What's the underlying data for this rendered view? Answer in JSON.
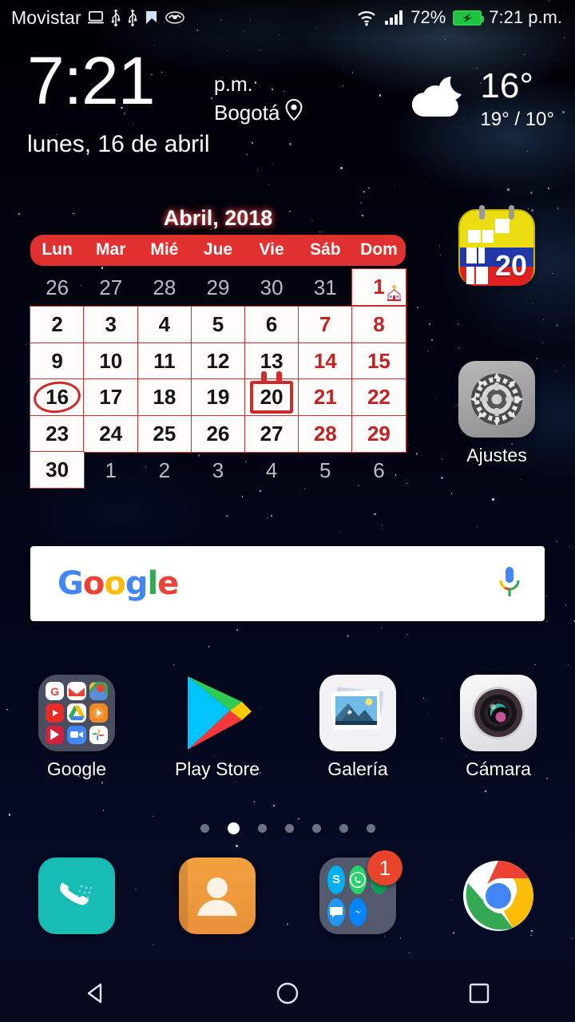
{
  "status_bar": {
    "carrier": "Movistar",
    "icons_left": [
      "laptop-icon",
      "usb-icon",
      "usb-icon",
      "check-flag-icon",
      "handshake-icon"
    ],
    "icons_right": [
      "wifi-icon",
      "signal-icon"
    ],
    "battery_percent": "72%",
    "battery_state": "charging",
    "time": "7:21 p.m."
  },
  "clock_widget": {
    "time": "7:21",
    "meridiem": "p.m.",
    "city": "Bogotá",
    "location_icon": "location-pin-icon",
    "date": "lunes, 16 de abril"
  },
  "weather_widget": {
    "icon": "cloud-moon-icon",
    "current_temp": "16°",
    "high_low": "19° / 10°"
  },
  "calendar_widget": {
    "title": "Abril, 2018",
    "weekdays": [
      "Lun",
      "Mar",
      "Mié",
      "Jue",
      "Vie",
      "Sáb",
      "Dom"
    ],
    "header_color": "#e03030",
    "grid": [
      [
        {
          "n": "26",
          "t": "out"
        },
        {
          "n": "27",
          "t": "out"
        },
        {
          "n": "28",
          "t": "out"
        },
        {
          "n": "29",
          "t": "out"
        },
        {
          "n": "30",
          "t": "out"
        },
        {
          "n": "31",
          "t": "out"
        },
        {
          "n": "1",
          "t": "in",
          "weekend": true,
          "marker": "church-icon"
        }
      ],
      [
        {
          "n": "2",
          "t": "in"
        },
        {
          "n": "3",
          "t": "in"
        },
        {
          "n": "4",
          "t": "in"
        },
        {
          "n": "5",
          "t": "in"
        },
        {
          "n": "6",
          "t": "in"
        },
        {
          "n": "7",
          "t": "in",
          "weekend": true
        },
        {
          "n": "8",
          "t": "in",
          "weekend": true
        }
      ],
      [
        {
          "n": "9",
          "t": "in"
        },
        {
          "n": "10",
          "t": "in"
        },
        {
          "n": "11",
          "t": "in"
        },
        {
          "n": "12",
          "t": "in"
        },
        {
          "n": "13",
          "t": "in"
        },
        {
          "n": "14",
          "t": "in",
          "weekend": true
        },
        {
          "n": "15",
          "t": "in",
          "weekend": true
        }
      ],
      [
        {
          "n": "16",
          "t": "in",
          "today": true
        },
        {
          "n": "17",
          "t": "in"
        },
        {
          "n": "18",
          "t": "in"
        },
        {
          "n": "19",
          "t": "in"
        },
        {
          "n": "20",
          "t": "in",
          "event": true
        },
        {
          "n": "21",
          "t": "in",
          "weekend": true
        },
        {
          "n": "22",
          "t": "in",
          "weekend": true
        }
      ],
      [
        {
          "n": "23",
          "t": "in"
        },
        {
          "n": "24",
          "t": "in"
        },
        {
          "n": "25",
          "t": "in"
        },
        {
          "n": "26",
          "t": "in"
        },
        {
          "n": "27",
          "t": "in"
        },
        {
          "n": "28",
          "t": "in",
          "weekend": true
        },
        {
          "n": "29",
          "t": "in",
          "weekend": true
        }
      ],
      [
        {
          "n": "30",
          "t": "in"
        },
        {
          "n": "1",
          "t": "out"
        },
        {
          "n": "2",
          "t": "out"
        },
        {
          "n": "3",
          "t": "out"
        },
        {
          "n": "4",
          "t": "out"
        },
        {
          "n": "5",
          "t": "out"
        },
        {
          "n": "6",
          "t": "out"
        }
      ]
    ]
  },
  "side_apps": [
    {
      "name": "calendar-app-icon",
      "label": "",
      "badge_number": "20"
    },
    {
      "name": "settings-app-icon",
      "label": "Ajustes"
    }
  ],
  "search": {
    "logo": "Google",
    "logo_letters": [
      {
        "c": "G",
        "color": "#4285f4"
      },
      {
        "c": "o",
        "color": "#ea4335"
      },
      {
        "c": "o",
        "color": "#fbbc05"
      },
      {
        "c": "g",
        "color": "#4285f4"
      },
      {
        "c": "l",
        "color": "#34a853"
      },
      {
        "c": "e",
        "color": "#ea4335"
      }
    ],
    "mic_icon": "microphone-icon",
    "placeholder": ""
  },
  "home_apps": [
    {
      "label": "Google",
      "icon": "google-folder-icon"
    },
    {
      "label": "Play Store",
      "icon": "play-store-icon"
    },
    {
      "label": "Galería",
      "icon": "gallery-icon"
    },
    {
      "label": "Cámara",
      "icon": "camera-icon"
    }
  ],
  "page_indicator": {
    "total": 7,
    "active_index": 1
  },
  "dock": [
    {
      "label": "",
      "icon": "phone-icon"
    },
    {
      "label": "",
      "icon": "contacts-icon"
    },
    {
      "label": "",
      "icon": "messaging-folder-icon",
      "badge": "1"
    },
    {
      "label": "",
      "icon": "chrome-icon"
    }
  ],
  "nav_bar": {
    "back": "back-triangle-icon",
    "home": "home-circle-icon",
    "recents": "recents-square-icon"
  },
  "colors": {
    "accent_red": "#cf2a2a",
    "badge_red": "#e8442c",
    "wallpaper_base": "#03040c"
  }
}
